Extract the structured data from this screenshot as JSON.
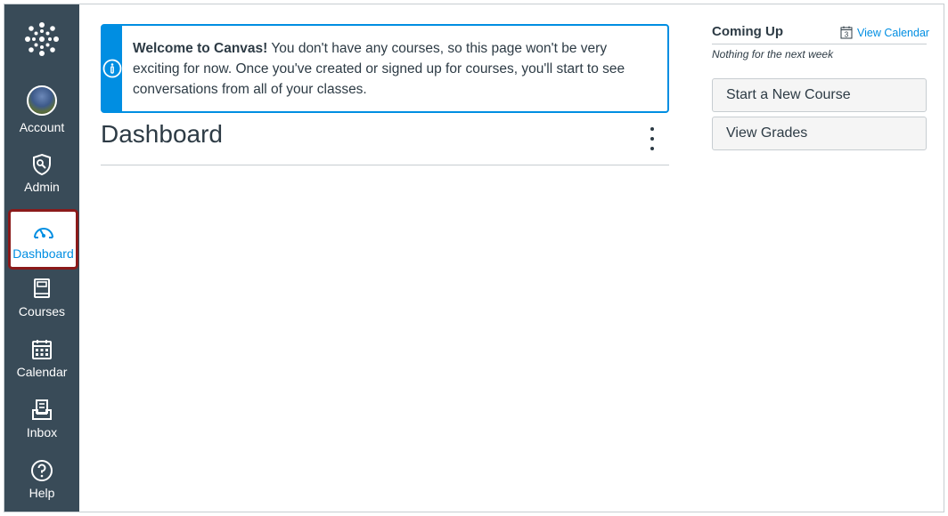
{
  "nav": {
    "items": [
      {
        "label": "Account",
        "icon": "avatar"
      },
      {
        "label": "Admin",
        "icon": "shield-wrench-icon"
      },
      {
        "label": "Dashboard",
        "icon": "speedometer-icon",
        "active": true
      },
      {
        "label": "Courses",
        "icon": "book-icon"
      },
      {
        "label": "Calendar",
        "icon": "calendar-icon"
      },
      {
        "label": "Inbox",
        "icon": "inbox-icon"
      },
      {
        "label": "Help",
        "icon": "help-icon"
      }
    ]
  },
  "alert": {
    "bold": "Welcome to Canvas!",
    "text": " You don't have any courses, so this page won't be very exciting for now. Once you've created or signed up for courses, you'll start to see conversations from all of your classes.",
    "icon": "info-icon"
  },
  "main": {
    "title": "Dashboard",
    "options_icon": "kebab-menu-icon"
  },
  "sidebar": {
    "coming_up": "Coming Up",
    "view_calendar": "View Calendar",
    "calendar_day": "3",
    "nothing": "Nothing for the next week",
    "buttons": [
      {
        "label": "Start a New Course"
      },
      {
        "label": "View Grades"
      }
    ]
  },
  "colors": {
    "nav_bg": "#394b58",
    "accent": "#008ee2",
    "highlight_border": "#8b1a1a",
    "text": "#2d3b45"
  }
}
